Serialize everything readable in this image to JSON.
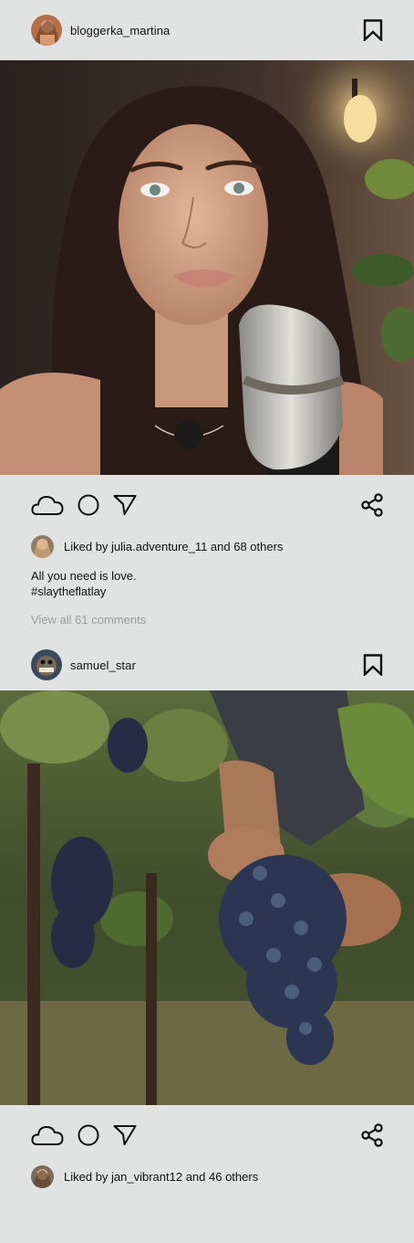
{
  "posts": [
    {
      "username": "bloggerka_martina",
      "likes_text": "Liked by julia.adventure_11 and 68 others",
      "caption_line1": "All you need is love.",
      "caption_line2": "#slaytheflatlay",
      "view_comments": "View all 61 comments",
      "photo": "portrait of woman with microphone"
    },
    {
      "username": "samuel_star",
      "likes_text": "Liked by jan_vibrant12 and 46 others",
      "photo": "hands holding bunch of grapes in vineyard"
    }
  ],
  "icons": {
    "bookmark": "bookmark-icon",
    "like": "cloud-icon",
    "comment": "circle-icon",
    "send": "send-icon",
    "share": "share-icon"
  }
}
